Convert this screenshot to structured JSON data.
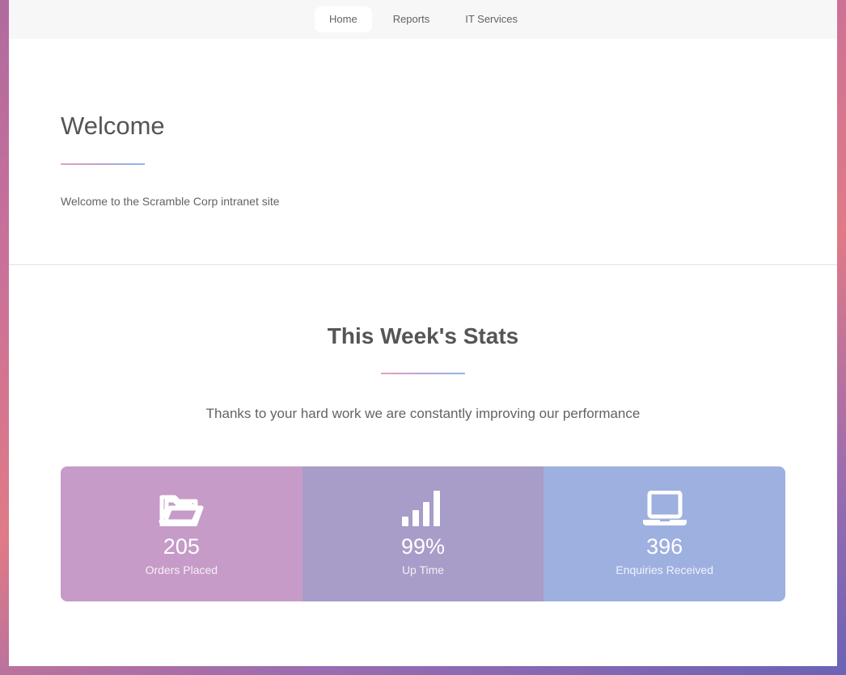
{
  "nav": {
    "items": [
      {
        "label": "Home",
        "active": true
      },
      {
        "label": "Reports"
      },
      {
        "label": "IT Services"
      }
    ]
  },
  "welcome": {
    "title": "Welcome",
    "text": "Welcome to the Scramble Corp intranet site"
  },
  "stats": {
    "title": "This Week's Stats",
    "subtitle": "Thanks to your hard work we are constantly improving our performance",
    "boxes": [
      {
        "icon": "folder-open-icon",
        "value": "205",
        "label": "Orders Placed",
        "color": "#c69bc8"
      },
      {
        "icon": "signal-bars-icon",
        "value": "99%",
        "label": "Up Time",
        "color": "#a89cc8"
      },
      {
        "icon": "laptop-icon",
        "value": "396",
        "label": "Enquiries Received",
        "color": "#9eb0e0"
      }
    ]
  }
}
